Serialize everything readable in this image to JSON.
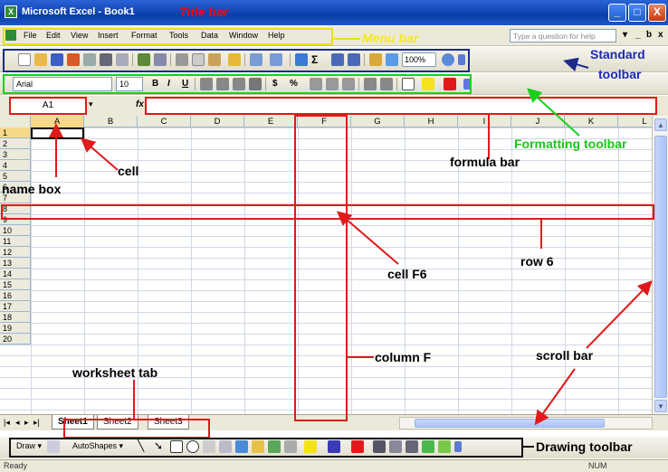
{
  "window": {
    "title": "Microsoft Excel - Book1",
    "app_icon": "excel-icon",
    "controls": [
      "_",
      "□",
      "X"
    ]
  },
  "menu": {
    "items": [
      "File",
      "Edit",
      "View",
      "Insert",
      "Format",
      "Tools",
      "Data",
      "Window",
      "Help"
    ],
    "ask_placeholder": "Type a question for help",
    "controls": [
      "▾",
      "_",
      "ƅ",
      "x"
    ]
  },
  "standard_toolbar": {
    "zoom": "100%"
  },
  "formatting_toolbar": {
    "font": "Arial",
    "size": "10",
    "bold": "B",
    "italic": "I",
    "underline": "U",
    "currency": "$",
    "percent": "%"
  },
  "formula_bar": {
    "name_box": "A1",
    "fx": "fx",
    "formula": ""
  },
  "grid": {
    "columns": [
      "A",
      "B",
      "C",
      "D",
      "E",
      "F",
      "G",
      "H",
      "I",
      "J",
      "K",
      "L"
    ],
    "rows": [
      "1",
      "2",
      "3",
      "4",
      "5",
      "6",
      "7",
      "8",
      "9",
      "10",
      "11",
      "12",
      "13",
      "14",
      "15",
      "16",
      "17",
      "18",
      "19",
      "20"
    ]
  },
  "sheet_tabs": {
    "nav": [
      "|◂",
      "◂",
      "▸",
      "▸|"
    ],
    "tabs": [
      "Sheet1",
      "Sheet2",
      "Sheet3"
    ],
    "active": "Sheet1"
  },
  "drawing_toolbar": {
    "draw": "Draw ▾",
    "autoshapes": "AutoShapes ▾"
  },
  "status_bar": {
    "left": "Ready",
    "right": "NUM"
  },
  "annotations": {
    "title_bar": "Title bar",
    "menu_bar": "Menu bar",
    "standard_toolbar_1": "Standard",
    "standard_toolbar_2": "toolbar",
    "formatting_toolbar": "Formatting toolbar",
    "formula_bar": "formula bar",
    "cell": "cell",
    "name_box": "name box",
    "row_6": "row 6",
    "cell_f6": "cell F6",
    "column_f": "column F",
    "scroll_bar": "scroll bar",
    "worksheet_tab": "worksheet tab",
    "drawing_toolbar": "Drawing toolbar"
  },
  "colors": {
    "title_blue": "#0a3ea8",
    "annotation_red": "#e01a1a",
    "annotation_yellow": "#e6e01a",
    "annotation_blue": "#1d2a8c",
    "annotation_green": "#17d11d",
    "selected_cell_border": "#000000"
  }
}
